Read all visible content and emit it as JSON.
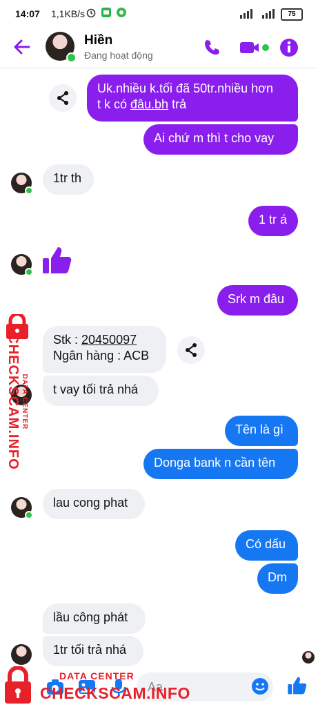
{
  "status": {
    "time": "14:07",
    "speed": "1,1KB/s",
    "sim1": "4G",
    "sim2": "4G",
    "battery": "75"
  },
  "header": {
    "name": "Hiền",
    "status": "Đang hoạt động"
  },
  "messages": {
    "m1_line1": "Uk.nhiều k.tối đã 50tr.nhiều hơn",
    "m1_line2a": "t k có ",
    "m1_link": "đâu.bh",
    "m1_line2b": " trả",
    "m2": "Ai chứ m thì t cho vay",
    "m3": "1tr th",
    "m4": "1 tr á",
    "m6": "Srk m đâu",
    "m7_label": "Stk : ",
    "m7_number": "20450097",
    "m7_line2": "Ngân hàng : ACB",
    "m8": "t vay tối trả nhá",
    "m9": "Tên là gì",
    "m10": "Donga bank n cần tên",
    "m11": "lau cong phat",
    "m12": "Có dấu",
    "m13": "Dm",
    "m14": "lầu công phát",
    "m15": "1tr tối trả nhá"
  },
  "composer": {
    "placeholder": "Aa"
  },
  "watermark": {
    "side_top": "DATA CENTER",
    "side_main": "CHECKSCAM.INFO",
    "bottom_top": "DATA CENTER",
    "bottom_main": "CHECKSCAM.INFO"
  },
  "colors": {
    "accent_purple": "#8a1fed",
    "accent_blue": "#1677f2",
    "incoming_bg": "#eef0f3",
    "watermark_red": "#e8202a"
  }
}
